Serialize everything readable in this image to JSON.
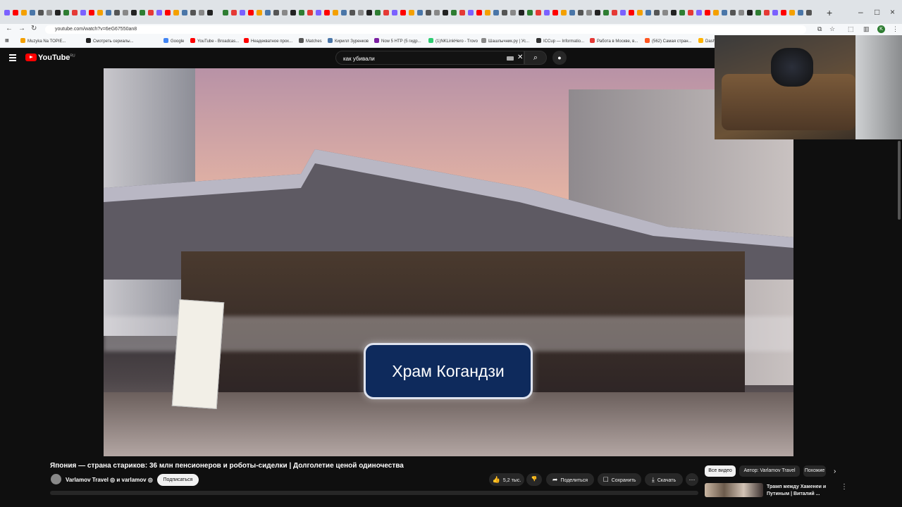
{
  "browser": {
    "url": "youtube.com/watch?v=6eG67550an8",
    "tab_close": "×",
    "new_tab": "+",
    "window_buttons": [
      "–",
      "□",
      "×"
    ],
    "profile_initial": "K",
    "bookmarks": [
      "Muzyka Na TOPIE...",
      "Смотреть сериалы...",
      "Google",
      "YouTube - Broadcas...",
      "Неадекватное прох...",
      "Matches",
      "Кирилл Зуренков",
      "Now 5 HTP (5 гидр...",
      "(1)NKLinkHero - Trovo",
      "Шашлычник.ру | Ус...",
      "ICCup — Informatio...",
      "Работа в Москве, в...",
      "(562) Самая стран...",
      "Dash"
    ]
  },
  "youtube": {
    "logo": "YouTube",
    "region": "RU",
    "search": {
      "value": "как убивали"
    },
    "video": {
      "caption": "Храм Когандзи"
    },
    "info": {
      "title": "Япония — страна стариков: 36 млн пенсионеров и роботы-сиделки | Долголетие ценой одиночества",
      "channel": "Varlamov Travel ◎ и varlamov ◎",
      "subscribe": "Подписаться",
      "likes": "5,2 тыс.",
      "share": "Поделиться",
      "save": "Сохранить",
      "download": "Скачать",
      "more": "⋯"
    },
    "chips": [
      "Все видео",
      "Автор: Varlamov Travel",
      "Похожие"
    ],
    "recommendation": {
      "title": "Трамп между Хаменеи и Путиным | Виталий ..."
    }
  },
  "colors": {
    "brand_red": "#ff0000",
    "caption_bg": "#0e2a5c",
    "page_bg": "#0f0f0f"
  }
}
